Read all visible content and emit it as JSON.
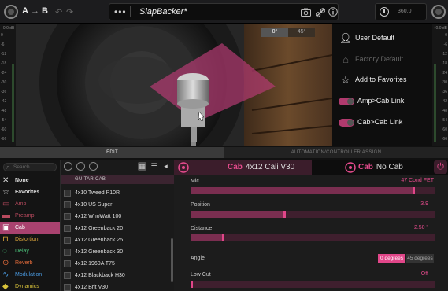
{
  "colors": {
    "accent": "#e14689",
    "accent_dark": "#3f1f2e",
    "bg": "#111111"
  },
  "toolbar": {
    "ab_a": "A",
    "ab_arrow": "→",
    "ab_b": "B",
    "undo": "↶",
    "redo": "↷",
    "preset_menu": "•••",
    "preset_name": "SlapBacker*",
    "camera_icon": "camera-icon",
    "link_icon": "link-icon",
    "info_icon": "info-icon",
    "bpm": "360.0"
  },
  "meters": {
    "left_labels": [
      "+0.0 dB",
      "0",
      "-6",
      "-12",
      "-18",
      "-24",
      "-30",
      "-36",
      "-42",
      "-48",
      "-54",
      "-60",
      "-66"
    ],
    "right_labels": [
      "+0.0 dB",
      "0",
      "-6",
      "-12",
      "-18",
      "-24",
      "-30",
      "-36",
      "-42",
      "-48",
      "-54",
      "-60",
      "-66"
    ]
  },
  "stage": {
    "angle_options": [
      "0°",
      "45°"
    ],
    "selected_angle": "0°"
  },
  "side_menu": {
    "user_default": "User Default",
    "factory_default": "Factory Default",
    "add_favorites": "Add to Favorites",
    "amp_cab_link": "Amp>Cab Link",
    "cab_cab_link": "Cab>Cab Link"
  },
  "tabs": {
    "edit": "EDIT",
    "automation": "AUTOMATION/CONTROLLER ASSIGN"
  },
  "search": {
    "placeholder": "Search"
  },
  "categories": [
    {
      "label": "None",
      "icon": "✕",
      "color": "#dddddd"
    },
    {
      "label": "Favorites",
      "icon": "☆",
      "color": "#dddddd"
    },
    {
      "label": "Amp",
      "icon": "▭",
      "color": "#b84a5e"
    },
    {
      "label": "Preamp",
      "icon": "▬",
      "color": "#b84a5e"
    },
    {
      "label": "Cab",
      "icon": "▣",
      "color": "#ffffff"
    },
    {
      "label": "Distortion",
      "icon": "⊓",
      "color": "#d8a23a"
    },
    {
      "label": "Delay",
      "icon": "◌",
      "color": "#4bc27a"
    },
    {
      "label": "Reverb",
      "icon": "⊙",
      "color": "#e06a3a"
    },
    {
      "label": "Modulation",
      "icon": "∿",
      "color": "#4a9ae0"
    },
    {
      "label": "Dynamics",
      "icon": "◆",
      "color": "#d8c23a"
    }
  ],
  "model_list": {
    "header": "GUITAR CAB",
    "items": [
      "4x10 Tweed P10R",
      "4x10 US Super",
      "4x12 WhoWatt 100",
      "4x12 Greenback 20",
      "4x12 Greenback 25",
      "4x12 Greenback 30",
      "4x12 1960A T75",
      "4x12 Blackback H30",
      "4x12 Brit V30"
    ]
  },
  "params": {
    "cab_a_kw": "Cab",
    "cab_a_name": "4x12 Cali V30",
    "cab_b_kw": "Cab",
    "cab_b_name": "No Cab",
    "mic_label": "Mic",
    "mic_value": "47 Cond FET",
    "position_label": "Position",
    "position_value": "3.9",
    "distance_label": "Distance",
    "distance_value": "2.50 \"",
    "angle_label": "Angle",
    "angle_on": "0 degrees",
    "angle_off": "45 degrees",
    "lowcut_label": "Low Cut",
    "lowcut_value": "Off"
  },
  "slider_levels": {
    "mic": 0.92,
    "position": 0.39,
    "distance": 0.14,
    "lowcut": 0.0
  }
}
